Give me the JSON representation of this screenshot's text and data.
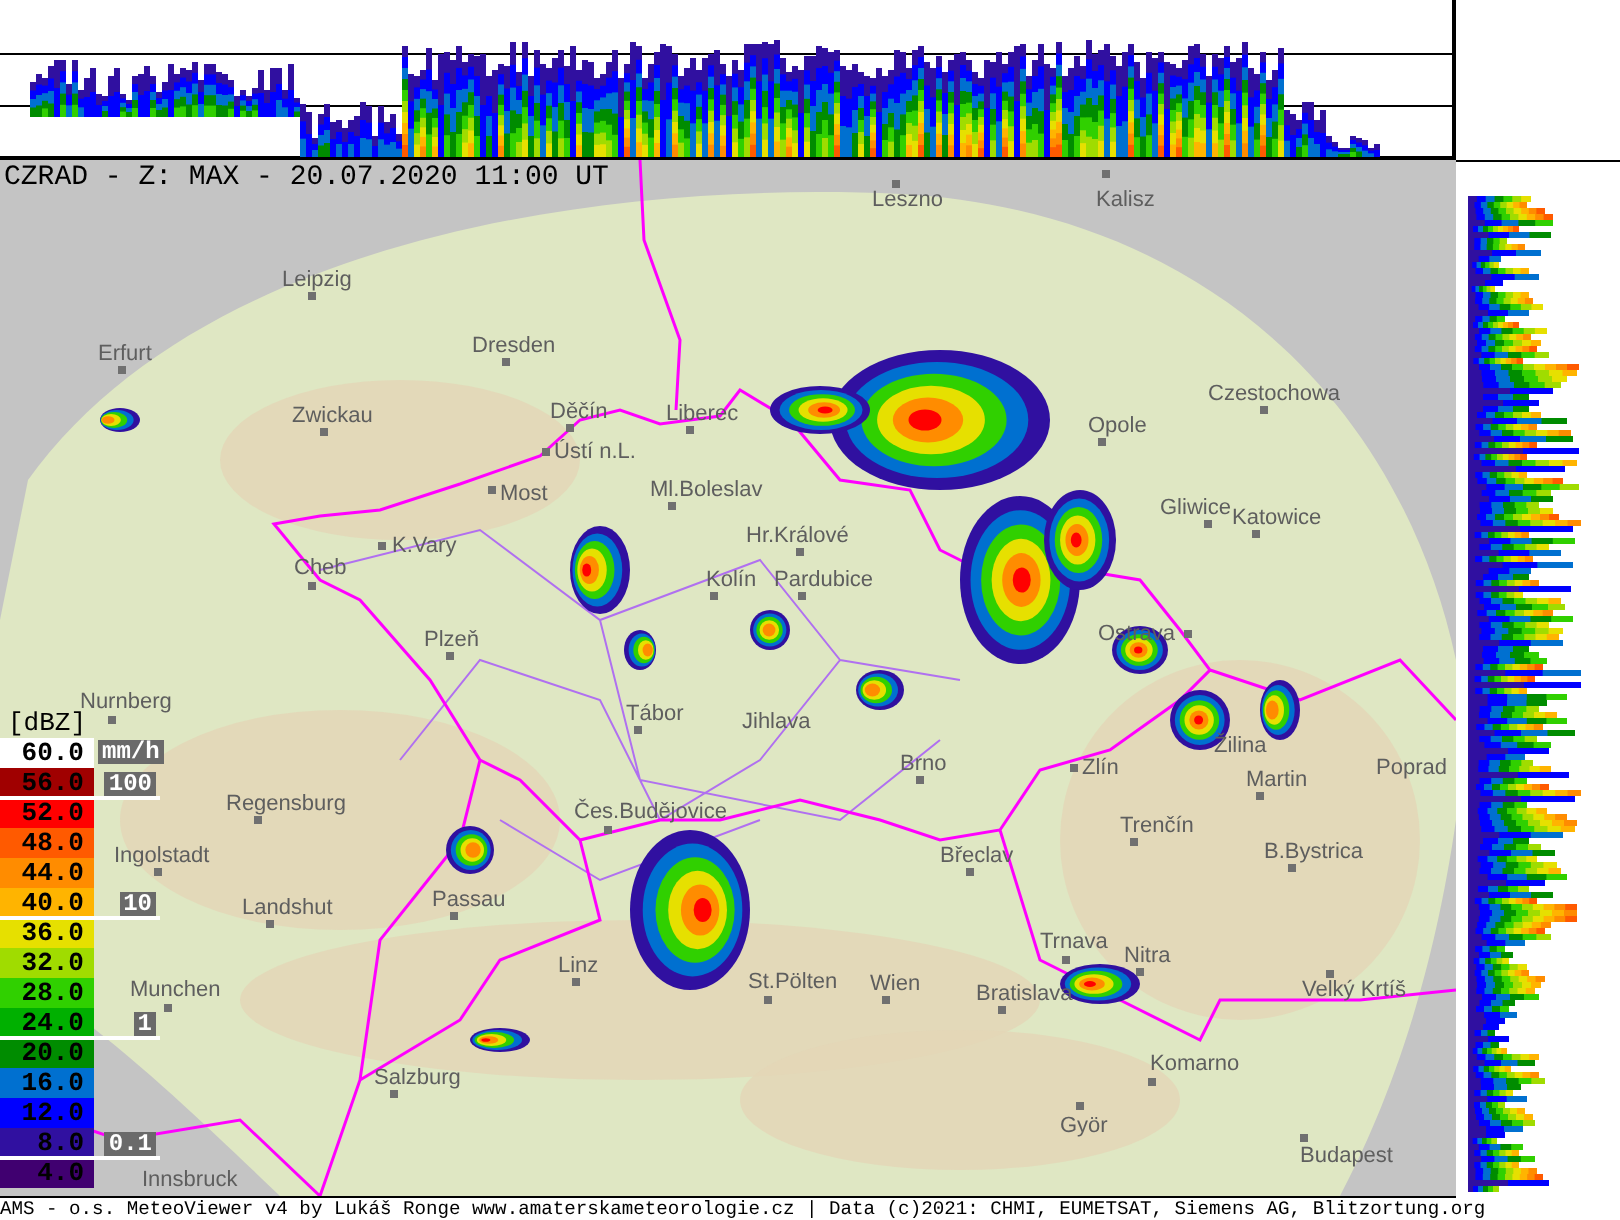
{
  "title": "CZRAD - Z: MAX - 20.07.2020 11:00 UT",
  "legend": {
    "unit": "[dBZ]",
    "rate_unit": "mm/h",
    "steps": [
      {
        "label": "60.0",
        "color": "#ffffff"
      },
      {
        "label": "56.0",
        "color": "#a00000"
      },
      {
        "label": "52.0",
        "color": "#ff0000"
      },
      {
        "label": "48.0",
        "color": "#ff5a00"
      },
      {
        "label": "44.0",
        "color": "#ff8c00"
      },
      {
        "label": "40.0",
        "color": "#ffb400"
      },
      {
        "label": "36.0",
        "color": "#e6e000"
      },
      {
        "label": "32.0",
        "color": "#a0dc00"
      },
      {
        "label": "28.0",
        "color": "#30d000"
      },
      {
        "label": "24.0",
        "color": "#00b000"
      },
      {
        "label": "20.0",
        "color": "#008c00"
      },
      {
        "label": "16.0",
        "color": "#0070d0"
      },
      {
        "label": "12.0",
        "color": "#0000ff"
      },
      {
        "label": "8.0",
        "color": "#3010a0"
      },
      {
        "label": "4.0",
        "color": "#400070"
      }
    ],
    "rate_marks": [
      "100",
      "10",
      "1",
      "0.1"
    ]
  },
  "cities": [
    {
      "name": "Leszno"
    },
    {
      "name": "Kalisz"
    },
    {
      "name": "Leipzig"
    },
    {
      "name": "Erfurt"
    },
    {
      "name": "Dresden"
    },
    {
      "name": "Czestochowa"
    },
    {
      "name": "Zwickau"
    },
    {
      "name": "Děčín"
    },
    {
      "name": "Liberec"
    },
    {
      "name": "Opole"
    },
    {
      "name": "Ústí n.L."
    },
    {
      "name": "Most"
    },
    {
      "name": "Ml.Boleslav"
    },
    {
      "name": "Gliwice"
    },
    {
      "name": "Katowice"
    },
    {
      "name": "Hr.Králové"
    },
    {
      "name": "K.Vary"
    },
    {
      "name": "Cheb"
    },
    {
      "name": "Kolín"
    },
    {
      "name": "Pardubice"
    },
    {
      "name": "Ostrava"
    },
    {
      "name": "Plzeň"
    },
    {
      "name": "Nurnberg"
    },
    {
      "name": "Tábor"
    },
    {
      "name": "Jihlava"
    },
    {
      "name": "Žilina"
    },
    {
      "name": "Brno"
    },
    {
      "name": "Zlín"
    },
    {
      "name": "Poprad"
    },
    {
      "name": "Martin"
    },
    {
      "name": "Regensburg"
    },
    {
      "name": "Čes.Budějovice"
    },
    {
      "name": "Trenčín"
    },
    {
      "name": "Ingolstadt"
    },
    {
      "name": "Břeclav"
    },
    {
      "name": "B.Bystrica"
    },
    {
      "name": "Passau"
    },
    {
      "name": "Landshut"
    },
    {
      "name": "Trnava"
    },
    {
      "name": "Nitra"
    },
    {
      "name": "Linz"
    },
    {
      "name": "Munchen"
    },
    {
      "name": "St.Pölten"
    },
    {
      "name": "Wien"
    },
    {
      "name": "Bratislava"
    },
    {
      "name": "Velký Krtíš"
    },
    {
      "name": "Komarno"
    },
    {
      "name": "Salzburg"
    },
    {
      "name": "Györ"
    },
    {
      "name": "Budapest"
    },
    {
      "name": "Innsbruck"
    }
  ],
  "footer": "AMS - o.s. MeteoViewer v4 by Lukáš Ronge www.amaterskameteorologie.cz | Data (c)2021: CHMI, EUMETSAT, Siemens AG, Blitzortung.org"
}
